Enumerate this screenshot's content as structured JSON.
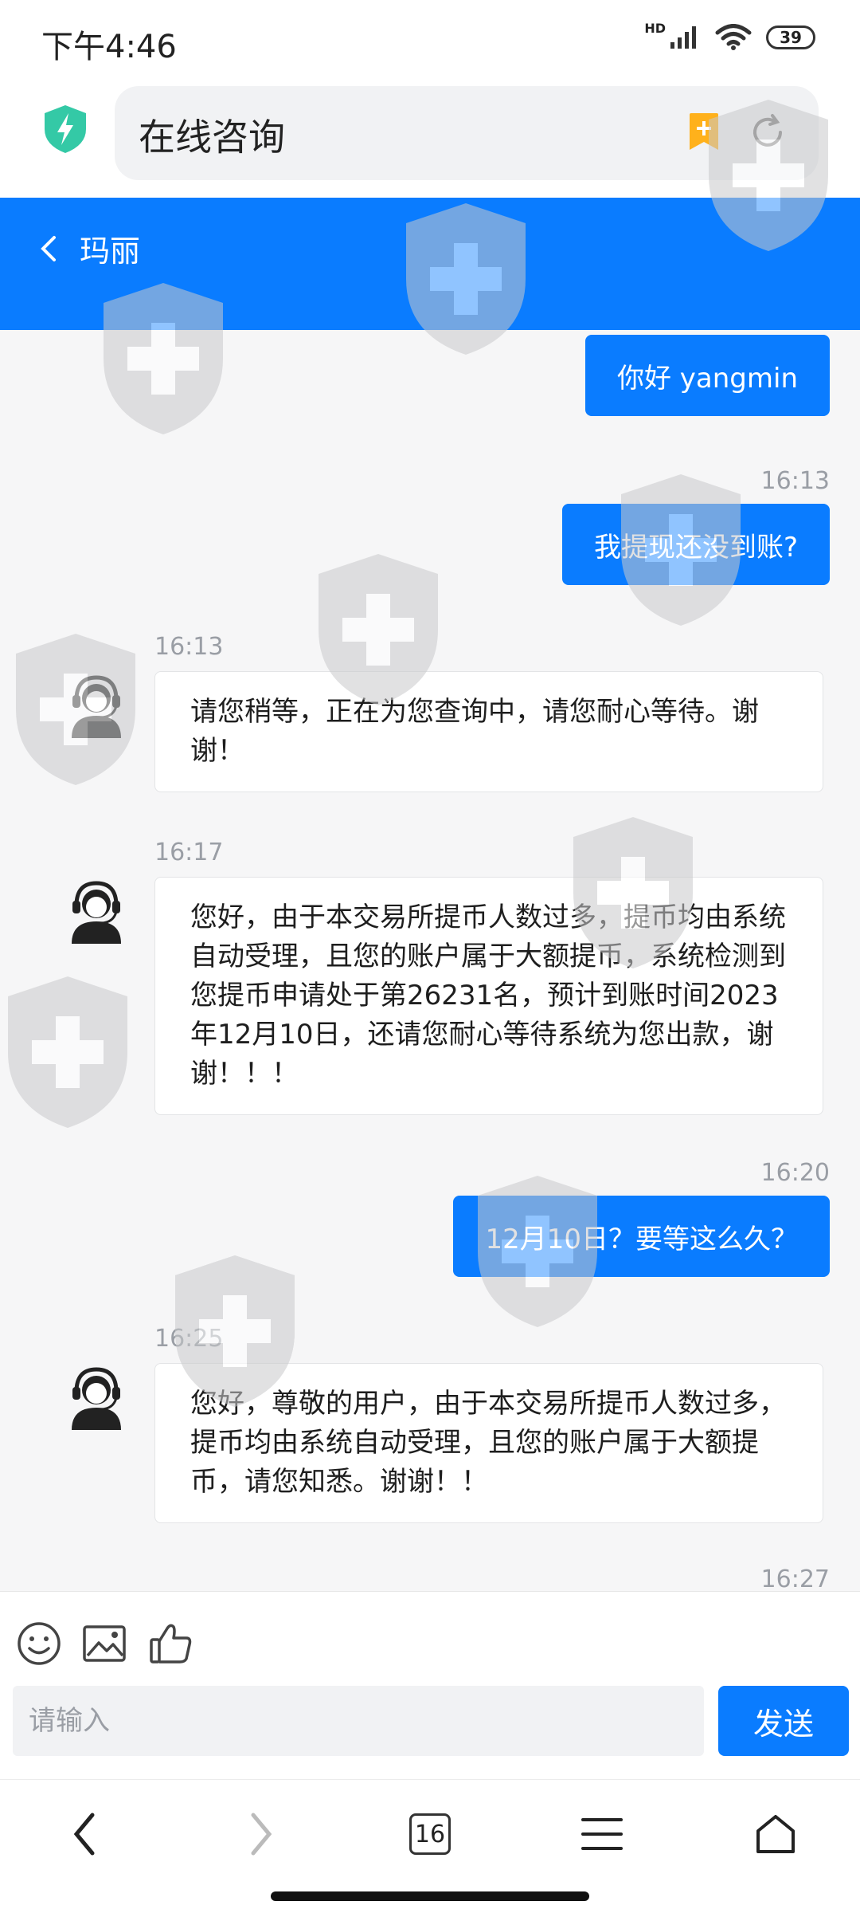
{
  "status_bar": {
    "time": "下午4:46",
    "network_label": "HD",
    "battery": "39"
  },
  "address_bar": {
    "title": "在线咨询"
  },
  "chat_header": {
    "agent_name": "玛丽"
  },
  "messages": [
    {
      "type": "outgoing",
      "text": "你好 yangmin"
    },
    {
      "type": "outgoing",
      "time": "16:13",
      "text": "我提现还没到账?"
    },
    {
      "type": "incoming",
      "time": "16:13",
      "text": "请您稍等，正在为您查询中，请您耐心等待。谢谢！"
    },
    {
      "type": "incoming",
      "time": "16:17",
      "text": "您好，由于本交易所提币人数过多，提币均由系统自动受理，且您的账户属于大额提币，系统检测到您提币申请处于第26231名，预计到账时间2023年12月10日，还请您耐心等待系统为您出款，谢谢！！！"
    },
    {
      "type": "outgoing",
      "time": "16:20",
      "text": "12月10日？要等这么久？"
    },
    {
      "type": "incoming",
      "time": "16:25",
      "text": "您好，尊敬的用户，由于本交易所提币人数过多，提币均由系统自动受理，且您的账户属于大额提币，请您知悉。谢谢！！"
    },
    {
      "type": "outgoing",
      "time": "16:27"
    }
  ],
  "input": {
    "placeholder": "请输入",
    "send_label": "发送"
  },
  "bottom_nav": {
    "tab_count": "16"
  },
  "colors": {
    "accent": "#0a7cff",
    "shield_green": "#34c9a6",
    "bookmark_orange": "#ffb11b"
  },
  "icons": [
    "shield-icon",
    "bookmark-icon",
    "reload-icon",
    "chevron-left-icon",
    "emoji-icon",
    "image-icon",
    "thumbs-up-icon",
    "menu-icon",
    "home-icon"
  ]
}
